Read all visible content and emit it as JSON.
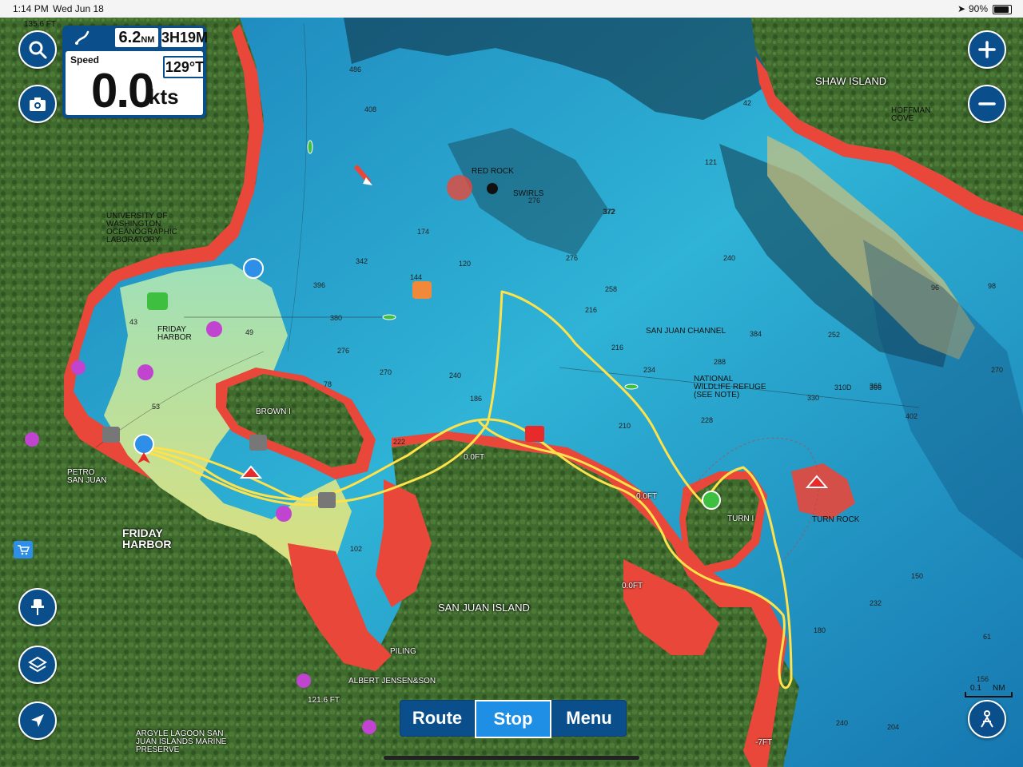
{
  "status_bar": {
    "time": "1:14 PM",
    "date": "Wed Jun 18",
    "battery": "90%"
  },
  "instrument": {
    "distance": "6.2",
    "distance_unit": "NM",
    "eta": "3h19m",
    "eta_display": "3H19M",
    "speed_label": "Speed",
    "speed_value": "0.0",
    "speed_unit": "kts",
    "heading": "129°T"
  },
  "controls": {
    "search_icon": "search-icon",
    "camera_icon": "camera-icon",
    "zoom_in_icon": "plus-icon",
    "zoom_out_icon": "minus-icon",
    "pin_icon": "pin-icon",
    "layers_icon": "layers-icon",
    "navigate_icon": "navigation-arrow-icon",
    "person_icon": "person-icon"
  },
  "bottom_bar": {
    "route": "Route",
    "stop": "Stop",
    "menu": "Menu"
  },
  "scale": {
    "value": "0.1",
    "unit": "NM"
  },
  "place_labels": {
    "shaw_island": "SHAW ISLAND",
    "hoffman_cove": "HOFFMAN\nCOVE",
    "uw_lab": "UNIVERSITY OF\nWASHINGTON\nOCEANOGRAPHIC\nLABORATORY",
    "friday_harbor_water": "FRIDAY\nHARBOR",
    "brown": "BROWN I",
    "petro": "PETRO\nSAN JUAN",
    "friday_harbor_town": "FRIDAY\nHARBOR",
    "san_juan_island": "SAN JUAN ISLAND",
    "san_juan_channel": "SAN JUAN CHANNEL",
    "wildlife_refuge": "NATIONAL\nWILDLIFE REFUGE\n(SEE NOTE)",
    "turn_i": "TURN I",
    "turn_rock": "TURN ROCK",
    "swirls": "SWIRLS",
    "red_rock": "RED ROCK",
    "albert_jensen": "ALBERT JENSEN&SON",
    "argyle_lagoon": "ARGYLE LAGOON SAN\nJUAN ISLANDS MARINE\nPRESERVE",
    "elev_121": "121.6 FT",
    "elev_135": "135.6 FT",
    "piling": "PILING",
    "oft_1": "0.0FT",
    "oft_2": "0.0FT",
    "oft_3": "0.0FT",
    "minus7": "-7FT"
  },
  "depths": [
    "486",
    "408",
    "396",
    "380",
    "276",
    "270",
    "240",
    "276",
    "258",
    "216",
    "234",
    "216",
    "210",
    "228",
    "288",
    "372",
    "384",
    "330",
    "310D",
    "366",
    "402",
    "270",
    "252",
    "180",
    "232",
    "204",
    "156",
    "61",
    "240",
    "222",
    "186",
    "102",
    "78",
    "49",
    "53",
    "43",
    "42",
    "121",
    "372",
    "240",
    "276",
    "144",
    "174",
    "342",
    "120",
    "96",
    "98",
    "366",
    "150"
  ],
  "colors": {
    "track": "#ffe14a",
    "land_shallow": "#e8473a",
    "deep": "#1a8fc2",
    "shallow": "#6fd4c0",
    "ui_blue": "#0a4f8c"
  }
}
